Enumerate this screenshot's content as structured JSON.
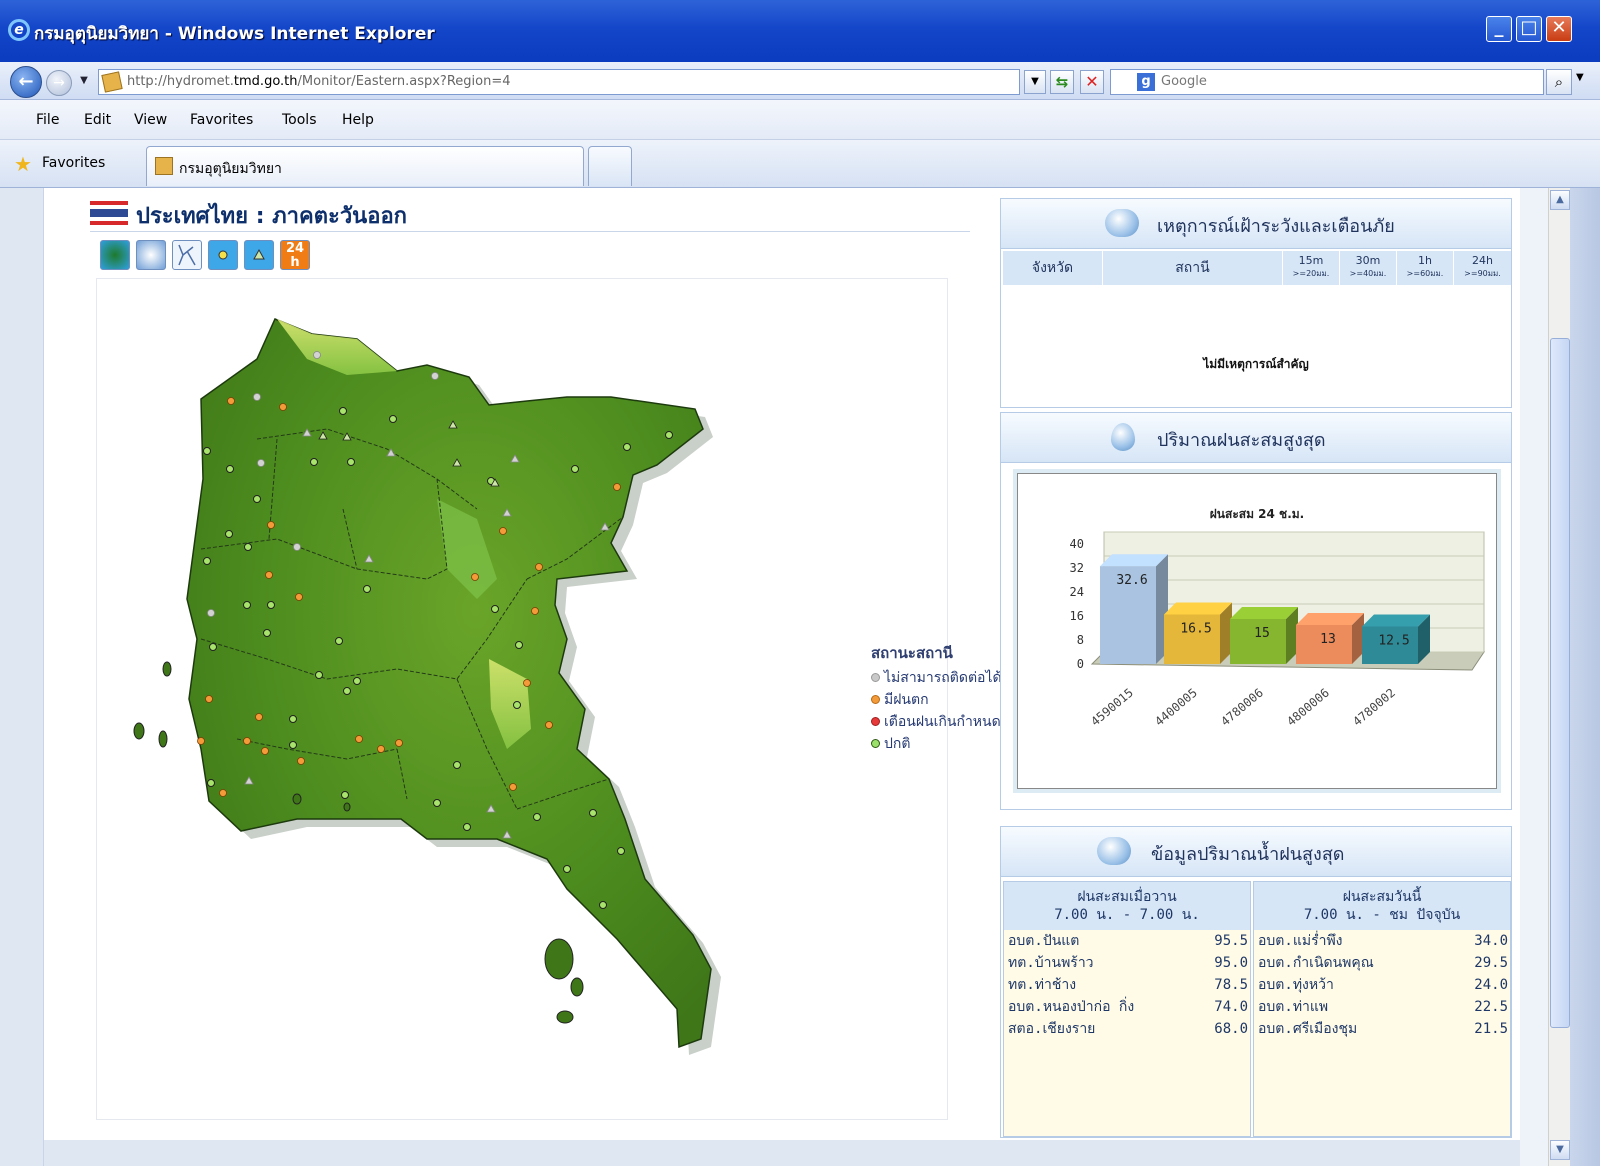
{
  "window": {
    "title": "กรมอุตุนิยมวิทยา - Windows Internet Explorer"
  },
  "address": {
    "url_prefix": "http://hydromet.",
    "url_domain": "tmd.go.th",
    "url_suffix": "/Monitor/Eastern.aspx?Region=4",
    "search_placeholder": "Google"
  },
  "menu": [
    "File",
    "Edit",
    "View",
    "Favorites",
    "Tools",
    "Help"
  ],
  "favorites": {
    "label": "Favorites",
    "tab_label": "กรมอุตุนิยมวิทยา"
  },
  "map": {
    "title": "ประเทศไทย : ภาคตะวันออก",
    "tools": [
      {
        "name": "map-terrain-tool",
        "color": "#2b9a3f"
      },
      {
        "name": "map-cloud-tool",
        "color": "#5d8fd0"
      },
      {
        "name": "map-river-tool",
        "color": "#6aa0d8"
      },
      {
        "name": "map-station-circle-tool",
        "color": "#3ea7e8"
      },
      {
        "name": "map-station-triangle-tool",
        "color": "#3ea7e8"
      },
      {
        "name": "map-24h-tool",
        "color": "#f07c16"
      }
    ],
    "tool_24h_text": "24",
    "tool_24h_sub": "h",
    "legend": {
      "title": "สถานะสถานี",
      "items": [
        {
          "label": "ไม่สามารถติดต่อได้",
          "color": "#c9c9c9"
        },
        {
          "label": "มีฝนตก",
          "color": "#f39a3a"
        },
        {
          "label": "เตือนฝนเกินกำหนด",
          "color": "#e63a3a"
        },
        {
          "label": "ปกติ",
          "color": "#9be06a"
        }
      ]
    }
  },
  "warning_panel": {
    "title": "เหตุการณ์เฝ้าระวังและเตือนภัย",
    "columns": [
      {
        "top": "จังหวัด",
        "sub": ""
      },
      {
        "top": "สถานี",
        "sub": ""
      },
      {
        "top": "15m",
        "sub": ">=20มม."
      },
      {
        "top": "30m",
        "sub": ">=40มม."
      },
      {
        "top": "1h",
        "sub": ">=60มม."
      },
      {
        "top": "24h",
        "sub": ">=90มม."
      }
    ],
    "empty_text": "ไม่มีเหตุการณ์สำคัญ"
  },
  "rain_chart_panel": {
    "title": "ปริมาณฝนสะสมสูงสุด"
  },
  "chart_data": {
    "type": "bar",
    "title": "ฝนสะสม 24 ช.ม.",
    "categories": [
      "4590015",
      "4400005",
      "4780006",
      "4800006",
      "4780002"
    ],
    "values": [
      32.6,
      16.5,
      15,
      13,
      12.5
    ],
    "value_labels": [
      "32.6",
      "16.5",
      "15",
      "13",
      "12.5"
    ],
    "colors": [
      "#a9c3e0",
      "#e4b63a",
      "#86b52f",
      "#ec8c5c",
      "#2e8a96"
    ],
    "ylim": [
      0,
      40
    ],
    "yticks": [
      "40",
      "32",
      "24",
      "16",
      "8",
      "0"
    ],
    "grid": true
  },
  "max_rain_panel": {
    "title": "ข้อมูลปริมาณน้ำฝนสูงสุด",
    "yesterday": {
      "header_line1": "ฝนสะสมเมื่อวาน",
      "header_line2": "7.00 น. - 7.00 น.",
      "rows": [
        {
          "name": "อบต.ปันแต",
          "value": "95.5"
        },
        {
          "name": "ทต.บ้านพร้าว",
          "value": "95.0"
        },
        {
          "name": "ทต.ท่าช้าง",
          "value": "78.5"
        },
        {
          "name": "อบต.หนองป่าก่อ กิ่ง",
          "value": "74.0"
        },
        {
          "name": "สตอ.เชียงราย",
          "value": "68.0"
        }
      ]
    },
    "today": {
      "header_line1": "ฝนสะสมวันนี้",
      "header_line2": "7.00 น. - ชม ปัจจุบัน",
      "rows": [
        {
          "name": "อบต.แม่ร่ำพึง",
          "value": "34.0"
        },
        {
          "name": "อบต.กำเนิดนพคุณ",
          "value": "29.5"
        },
        {
          "name": "อบต.ทุ่งหว้า",
          "value": "24.0"
        },
        {
          "name": "อบต.ท่าแพ",
          "value": "22.5"
        },
        {
          "name": "อบต.ศรีเมืองชุม",
          "value": "21.5"
        }
      ]
    }
  }
}
